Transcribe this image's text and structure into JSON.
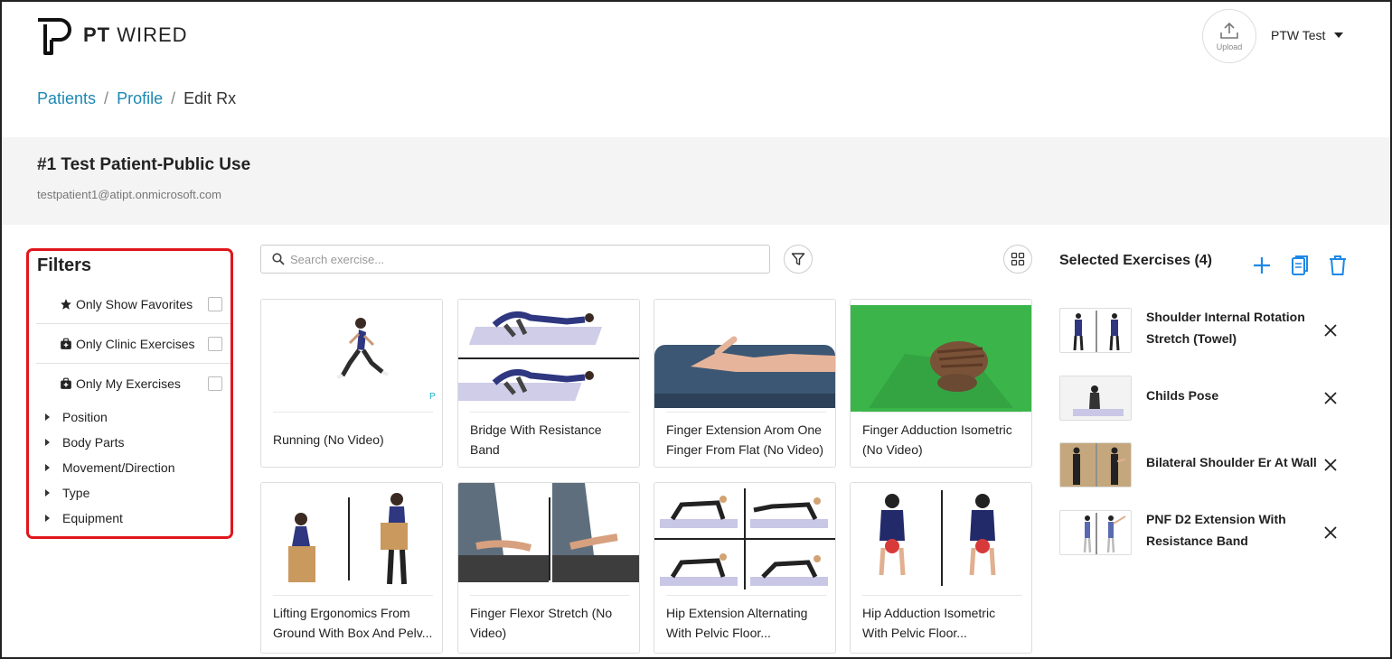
{
  "header": {
    "logo_bold": "PT",
    "logo_light": " WIRED",
    "upload_label": "Upload",
    "user_name": "PTW Test"
  },
  "breadcrumb": {
    "items": [
      "Patients",
      "Profile",
      "Edit Rx"
    ],
    "separator": "/"
  },
  "patient": {
    "name": "#1 Test Patient-Public Use",
    "email": "testpatient1@atipt.onmicrosoft.com"
  },
  "filters": {
    "title": "Filters",
    "toggles": [
      {
        "label": "Only Show Favorites",
        "icon": "star-icon",
        "checked": false
      },
      {
        "label": "Only Clinic Exercises",
        "icon": "medical-bag-icon",
        "checked": false
      },
      {
        "label": "Only My Exercises",
        "icon": "medical-bag-icon",
        "checked": false
      }
    ],
    "categories": [
      "Position",
      "Body Parts",
      "Movement/Direction",
      "Type",
      "Equipment"
    ]
  },
  "search": {
    "placeholder": "Search exercise...",
    "value": ""
  },
  "exercises": [
    {
      "title": "Running (No Video)"
    },
    {
      "title": "Bridge With Resistance Band"
    },
    {
      "title": "Finger Extension Arom One Finger From Flat (No Video)"
    },
    {
      "title": "Finger Adduction Isometric (No Video)"
    },
    {
      "title": "Lifting Ergonomics From Ground With Box And Pelv..."
    },
    {
      "title": "Finger Flexor Stretch (No Video)"
    },
    {
      "title": "Hip Extension Alternating With Pelvic Floor..."
    },
    {
      "title": "Hip Adduction Isometric With Pelvic Floor..."
    }
  ],
  "selected": {
    "title": "Selected Exercises (4)",
    "items": [
      {
        "name": "Shoulder Internal Rotation Stretch (Towel)"
      },
      {
        "name": "Childs Pose"
      },
      {
        "name": "Bilateral Shoulder Er At Wall"
      },
      {
        "name": "PNF D2 Extension With Resistance Band"
      }
    ]
  },
  "colors": {
    "link": "#1e88b4",
    "filter_border": "#e0161b",
    "tool_icon": "#1e88e5",
    "patient_band": "#f4f4f4"
  }
}
